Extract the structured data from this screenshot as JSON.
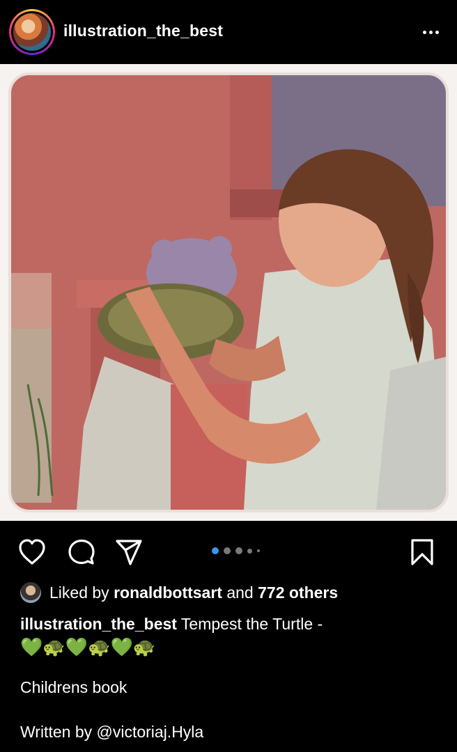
{
  "header": {
    "username": "illustration_the_best",
    "more_icon": "more-horizontal-icon"
  },
  "post": {
    "image_description": "",
    "pager": {
      "total": 5,
      "active_index": 0,
      "active_color": "#3897f0"
    }
  },
  "actions": {
    "like_icon": "heart-icon",
    "comment_icon": "comment-icon",
    "share_icon": "send-icon",
    "save_icon": "bookmark-icon"
  },
  "likes": {
    "prefix": "Liked by",
    "user": "ronaldbottsart",
    "middle": "and",
    "others": "772 others"
  },
  "caption": {
    "username": "illustration_the_best",
    "text": "Tempest the Turtle -",
    "emoji_line": "💚🐢💚🐢💚🐢",
    "line2": "Childrens book",
    "line3": "Written by @victoriaj.Hyla"
  }
}
